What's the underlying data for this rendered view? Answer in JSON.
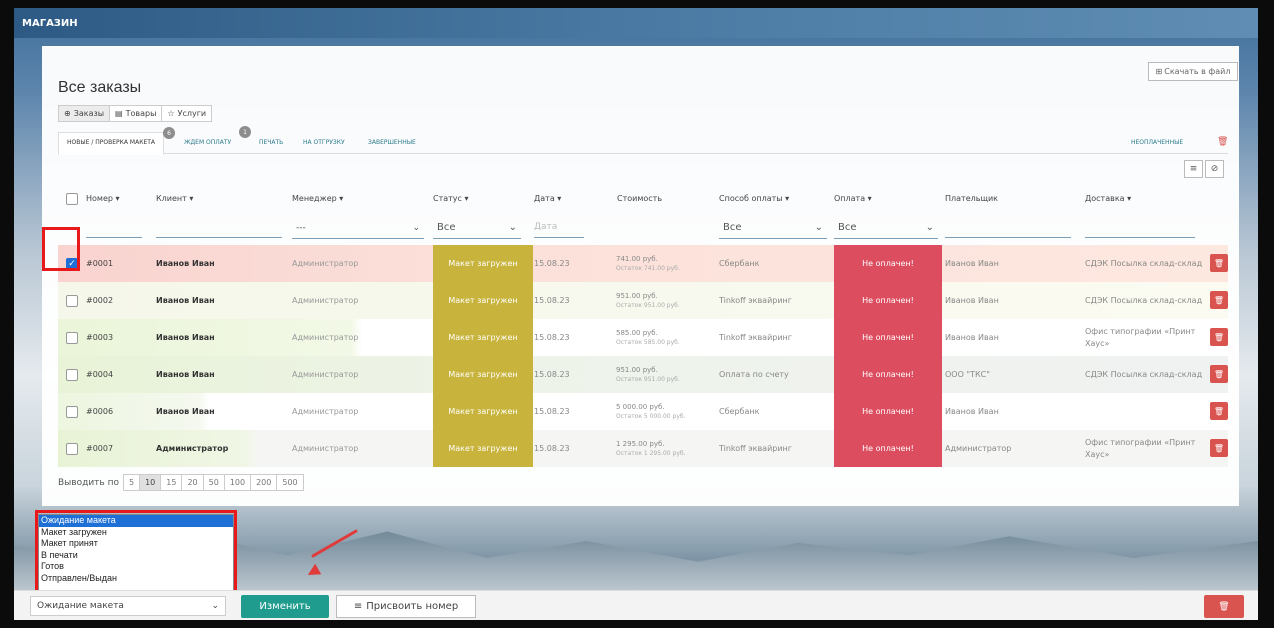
{
  "app": {
    "title": "МАГАЗИН"
  },
  "page": {
    "title": "Все заказы",
    "download_label": "Скачать в файл"
  },
  "view_tabs": [
    {
      "label": "Заказы",
      "icon": "box-icon",
      "active": true
    },
    {
      "label": "Товары",
      "icon": "print-icon",
      "active": false
    },
    {
      "label": "Услуги",
      "icon": "star-icon",
      "active": false
    }
  ],
  "status_tabs": [
    {
      "label": "НОВЫЕ / ПРОВЕРКА МАКЕТА",
      "badge": "6",
      "active": true
    },
    {
      "label": "ЖДЕМ ОПЛАТУ",
      "badge": "1",
      "active": false
    },
    {
      "label": "ПЕЧАТЬ",
      "badge": "",
      "active": false
    },
    {
      "label": "НА ОТГРУЗКУ",
      "badge": "",
      "active": false
    },
    {
      "label": "ЗАВЕРШЕННЫЕ",
      "badge": "",
      "active": false
    }
  ],
  "unpaid_link": "НЕОПЛАЧЕННЫЕ",
  "columns": {
    "number": "Номер ▾",
    "client": "Клиент ▾",
    "manager": "Менеджер ▾",
    "status": "Статус ▾",
    "date": "Дата ▾",
    "cost": "Стоимость",
    "payment_method": "Способ оплаты ▾",
    "payment": "Оплата ▾",
    "payer": "Плательщик",
    "delivery": "Доставка ▾"
  },
  "filters": {
    "manager": "---",
    "status": "Все",
    "date_placeholder": "Дата",
    "payment_method": "Все",
    "payment": "Все"
  },
  "orders": [
    {
      "number": "#0001",
      "client": "Иванов Иван",
      "manager": "Администратор",
      "status": "Макет загружен",
      "date": "15.08.23",
      "cost": "741.00 руб.",
      "remainder": "Остаток 741.00 руб.",
      "payment_method": "Сбербанк",
      "payment": "Не оплачен!",
      "payer": "Иванов Иван",
      "delivery": "СДЭК Посылка склад-склад",
      "checked": true
    },
    {
      "number": "#0002",
      "client": "Иванов Иван",
      "manager": "Администратор",
      "status": "Макет загружен",
      "date": "15.08.23",
      "cost": "951.00 руб.",
      "remainder": "Остаток 951.00 руб.",
      "payment_method": "Tinkoff эквайринг",
      "payment": "Не оплачен!",
      "payer": "Иванов Иван",
      "delivery": "СДЭК Посылка склад-склад",
      "checked": false
    },
    {
      "number": "#0003",
      "client": "Иванов Иван",
      "manager": "Администратор",
      "status": "Макет загружен",
      "date": "15.08.23",
      "cost": "585.00 руб.",
      "remainder": "Остаток 585.00 руб.",
      "payment_method": "Tinkoff эквайринг",
      "payment": "Не оплачен!",
      "payer": "Иванов Иван",
      "delivery": "Офис типографии «Принт Хаус»",
      "checked": false
    },
    {
      "number": "#0004",
      "client": "Иванов Иван",
      "manager": "Администратор",
      "status": "Макет загружен",
      "date": "15.08.23",
      "cost": "951.00 руб.",
      "remainder": "Остаток 951.00 руб.",
      "payment_method": "Оплата по счету",
      "payment": "Не оплачен!",
      "payer": "ООО \"ТКС\"",
      "delivery": "СДЭК Посылка склад-склад",
      "checked": false
    },
    {
      "number": "#0006",
      "client": "Иванов Иван",
      "manager": "Администратор",
      "status": "Макет загружен",
      "date": "15.08.23",
      "cost": "5 000.00 руб.",
      "remainder": "Остаток 5 000.00 руб.",
      "payment_method": "Сбербанк",
      "payment": "Не оплачен!",
      "payer": "Иванов Иван",
      "delivery": "",
      "checked": false
    },
    {
      "number": "#0007",
      "client": "Администратор",
      "manager": "Администратор",
      "status": "Макет загружен",
      "date": "15.08.23",
      "cost": "1 295.00 руб.",
      "remainder": "Остаток 1 295.00 руб.",
      "payment_method": "Tinkoff эквайринг",
      "payment": "Не оплачен!",
      "payer": "Администратор",
      "delivery": "Офис типографии «Принт Хаус»",
      "checked": false
    }
  ],
  "per_page": {
    "label": "Выводить по",
    "options": [
      "5",
      "10",
      "15",
      "20",
      "50",
      "100",
      "200",
      "500"
    ],
    "selected": "10"
  },
  "status_dropdown": {
    "options": [
      "Ожидание макета",
      "Макет загружен",
      "Макет принят",
      "В печати",
      "Готов",
      "Отправлен/Выдан"
    ],
    "selected": "Ожидание макета"
  },
  "bottom_bar": {
    "status_value": "Ожидание макета",
    "change_label": "Изменить",
    "assign_label": "Присвоить номер"
  },
  "colors": {
    "status_uploaded": "#c8b43c",
    "unpaid": "#dc4d5f",
    "accent_teal": "#1f9c8d",
    "highlight_red": "#e8191a"
  }
}
